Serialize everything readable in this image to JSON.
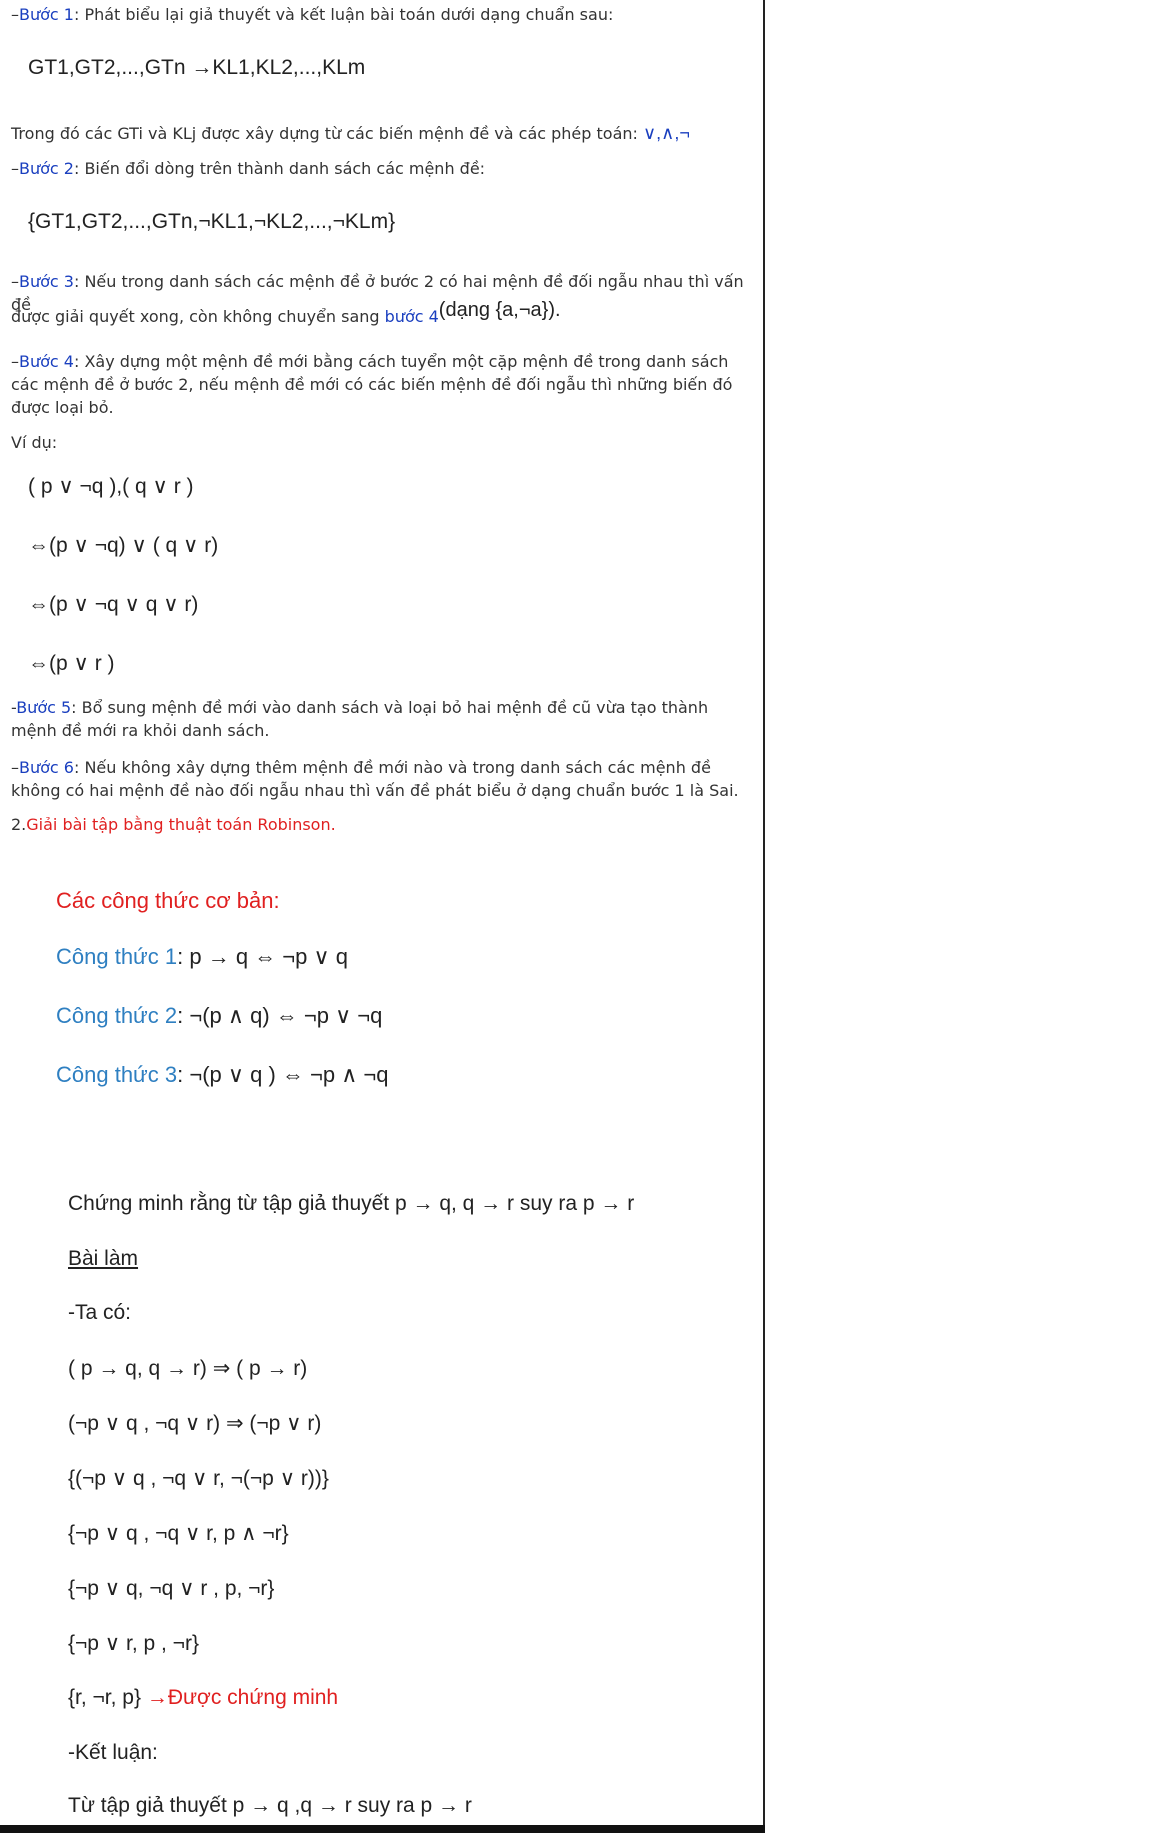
{
  "steps": {
    "b1_label": "Bước 1",
    "b1_text": ": Phát biểu lại giả thuyết và kết luận bài toán dưới dạng chuẩn sau:",
    "b1_formula": "GT1,GT2,...,GTn →KL1,KL2,...,KLm",
    "b1_note": "Trong đó các GTi và KLj được xây dựng từ các biến mệnh đề và các phép toán: ",
    "b1_ops": "∨,∧,¬",
    "b2_label": "Bước 2",
    "b2_text": ": Biến đổi dòng trên thành danh sách các mệnh đề:",
    "b2_formula": "{GT1,GT2,...,GTn,¬KL1,¬KL2,...,¬KLm}",
    "b3_label": "Bước 3",
    "b3_text": ": Nếu trong danh sách các mệnh đề ở bước 2 có hai mệnh đề đối ngẫu nhau thì vấn đề",
    "b3_text2": "được giải quyết xong, còn không chuyển sang ",
    "b3_link": "bước 4",
    "b3_form": "(dạng {a,¬a}).",
    "b4_label": "Bước 4",
    "b4_text": ": Xây dựng một mệnh đề mới bằng cách tuyển một cặp mệnh đề trong danh sách các mệnh đề ở bước 2, nếu mệnh đề mới có các biến mệnh đề đối ngẫu thì những biến đó được loại bỏ.",
    "example_label": "Ví dụ:",
    "ex1": "( p ∨ ¬q ),( q ∨ r )",
    "ex2": "⇔(p ∨ ¬q) ∨ ( q ∨ r)",
    "ex3": "⇔(p ∨ ¬q ∨ q ∨ r)",
    "ex4": "⇔(p ∨ r )",
    "b5_label": "Bước 5",
    "b5_text": ": Bổ sung mệnh đề mới vào danh sách và loại bỏ hai mệnh đề cũ vừa tạo thành mệnh đề mới ra khỏi danh sách.",
    "b6_label": "Bước 6",
    "b6_text": ": Nếu không xây dựng thêm mệnh đề mới nào và trong danh sách các mệnh đề không có hai mệnh đề nào đối ngẫu nhau thì vấn đề phát biểu ở dạng chuẩn bước 1 là Sai.",
    "section2_num": "2.",
    "section2_title": "Giải bài tập bằng thuật toán Robinson."
  },
  "formulas": {
    "title": "Các công thức cơ bản:",
    "f1_label": "Công thức 1",
    "f1_expr": ": p → q ⇔ ¬p ∨ q",
    "f2_label": "Công thức 2",
    "f2_expr": ": ¬(p ∧ q) ⇔ ¬p ∨ ¬q",
    "f3_label": "Công thức 3",
    "f3_expr": ": ¬(p ∨ q ) ⇔ ¬p ∧ ¬q"
  },
  "proof": {
    "problem": "Chứng minh rằng từ tập giả thuyết  p → q, q → r suy ra  p → r",
    "heading": "Bài làm",
    "intro": "-Ta có:",
    "lines": [
      "( p → q, q → r) ⇒ ( p → r)",
      "(¬p ∨ q , ¬q ∨ r) ⇒ (¬p ∨ r)",
      "{(¬p ∨ q , ¬q ∨ r, ¬(¬p ∨ r))}",
      "{¬p ∨ q , ¬q ∨ r, p ∧ ¬r}",
      "{¬p ∨ q, ¬q ∨ r , p, ¬r}",
      "{¬p ∨ r, p , ¬r}",
      "{r, ¬r, p}"
    ],
    "proved": " →Được chứng minh",
    "conclusion_label": "-Kết luận:",
    "conclusion": "Từ tập giả thuyết p → q ,q → r suy ra p → r"
  }
}
